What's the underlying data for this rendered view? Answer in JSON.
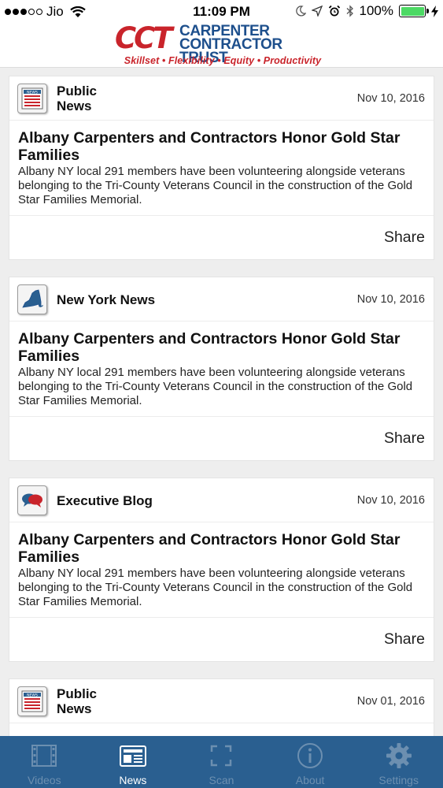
{
  "status_bar": {
    "carrier": "Jio",
    "time": "11:09 PM",
    "battery": "100%",
    "signal_bars": 3,
    "icons": [
      "wifi-icon",
      "moon-icon",
      "location-arrow-icon",
      "alarm-icon",
      "bluetooth-icon",
      "charging-bolt-icon"
    ]
  },
  "header": {
    "logo_mark": "CCT",
    "logo_line1": "CARPENTER",
    "logo_line2": "CONTRACTOR TRUST",
    "tagline": "Skillset • Flexibility • Equity • Productivity"
  },
  "feed": {
    "cards": [
      {
        "source": "Public News",
        "source_icon": "newspaper-icon",
        "date": "Nov 10, 2016",
        "title": "Albany Carpenters and Contractors Honor Gold Star Families",
        "summary": "Albany NY local 291 members have been volunteering alongside veterans belonging to the Tri-County Veterans Council in the construction of the Gold Star Families Memorial.",
        "share_label": "Share"
      },
      {
        "source": "New York News",
        "source_icon": "new-york-state-icon",
        "date": "Nov 10, 2016",
        "title": "Albany Carpenters and Contractors Honor Gold Star Families",
        "summary": "Albany NY local 291 members have been volunteering alongside veterans belonging to the Tri-County Veterans Council in the construction of the Gold Star Families Memorial.",
        "share_label": "Share"
      },
      {
        "source": "Executive Blog",
        "source_icon": "speech-bubbles-icon",
        "date": "Nov 10, 2016",
        "title": "Albany Carpenters and Contractors Honor Gold Star Families",
        "summary": "Albany NY local 291 members have been volunteering alongside veterans belonging to the Tri-County Veterans Council in the construction of the Gold Star Families Memorial.",
        "share_label": "Share"
      },
      {
        "source": "Public News",
        "source_icon": "newspaper-icon",
        "date": "Nov 01, 2016"
      }
    ]
  },
  "tab_bar": {
    "tabs": [
      {
        "label": "Videos",
        "icon": "film-icon",
        "active": false
      },
      {
        "label": "News",
        "icon": "newspaper-tab-icon",
        "active": true
      },
      {
        "label": "Scan",
        "icon": "scan-frame-icon",
        "active": false
      },
      {
        "label": "About",
        "icon": "info-circle-icon",
        "active": false
      },
      {
        "label": "Settings",
        "icon": "gear-icon",
        "active": false
      }
    ]
  },
  "colors": {
    "brand_red": "#c9242b",
    "brand_blue": "#1d4f8c",
    "tab_bar_bg": "#2a5f90",
    "tab_inactive": "#6c8fb0",
    "tab_active": "#ffffff",
    "battery_green": "#4cd964"
  }
}
